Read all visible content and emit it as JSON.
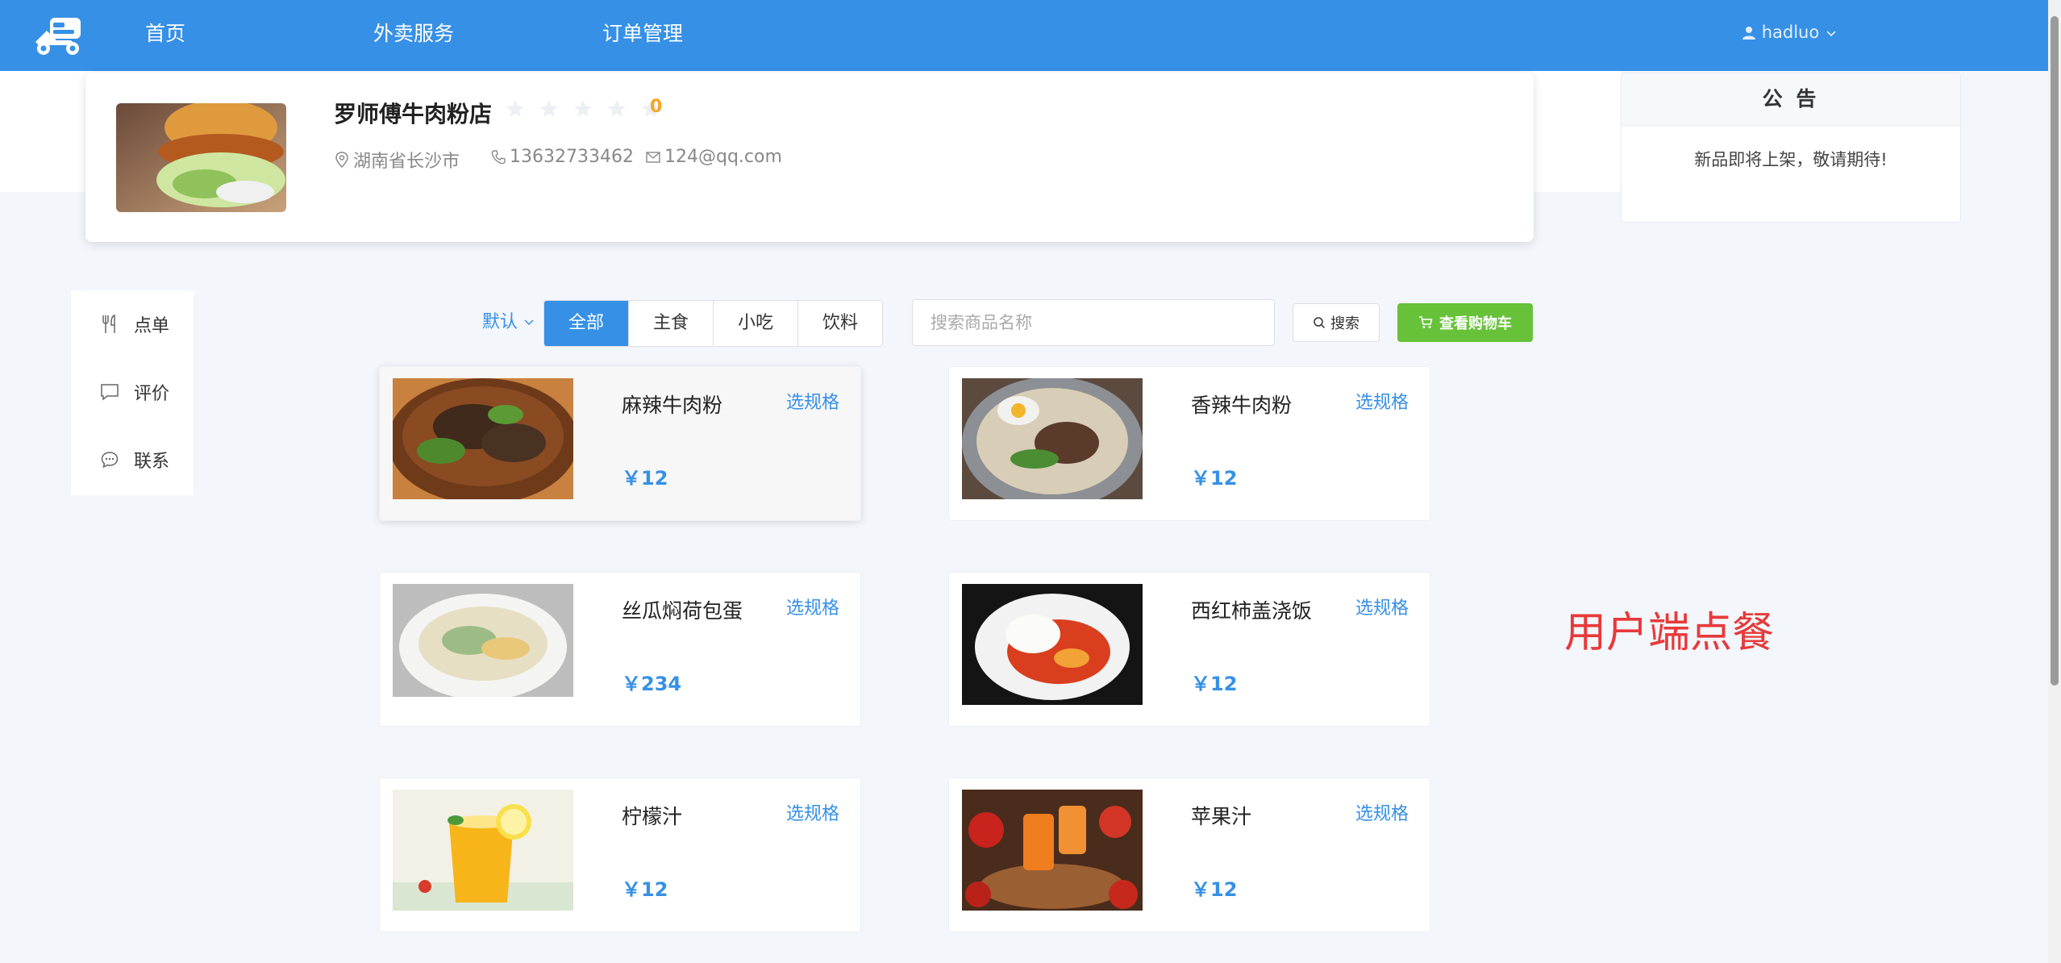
{
  "nav": {
    "items": [
      {
        "label": "首页"
      },
      {
        "label": "外卖服务"
      },
      {
        "label": "订单管理"
      }
    ],
    "user": "hadluo"
  },
  "shop": {
    "name": "罗师傅牛肉粉店",
    "rating_value": 0,
    "rating_label": "0",
    "rating_max": 5,
    "address": "湖南省长沙市",
    "phone": "13632733462",
    "email": "124@qq.com"
  },
  "notice": {
    "title": "公 告",
    "content": "新品即将上架，敬请期待!"
  },
  "side_menu": {
    "items": [
      {
        "label": "点单",
        "icon": "fork-knife-icon"
      },
      {
        "label": "评价",
        "icon": "comment-icon"
      },
      {
        "label": "联系",
        "icon": "chat-dots-icon"
      }
    ]
  },
  "filter": {
    "sort_label": "默认",
    "tabs": [
      "全部",
      "主食",
      "小吃",
      "饮料"
    ],
    "active_tab": "全部",
    "search_placeholder": "搜索商品名称",
    "search_value": "",
    "search_button": "搜索",
    "cart_button": "查看购物车"
  },
  "products": [
    {
      "name": "麻辣牛肉粉",
      "price": "￥12",
      "spec_label": "选规格"
    },
    {
      "name": "香辣牛肉粉",
      "price": "￥12",
      "spec_label": "选规格"
    },
    {
      "name": "丝瓜焖荷包蛋",
      "price": "￥234",
      "spec_label": "选规格"
    },
    {
      "name": "西红柿盖浇饭",
      "price": "￥12",
      "spec_label": "选规格"
    },
    {
      "name": "柠檬汁",
      "price": "￥12",
      "spec_label": "选规格"
    },
    {
      "name": "苹果汁",
      "price": "￥12",
      "spec_label": "选规格"
    }
  ],
  "caption": "用户端点餐",
  "colors": {
    "primary": "#3690e6",
    "success": "#67c23a",
    "rating": "#f5a623",
    "caption": "#e8393a"
  }
}
